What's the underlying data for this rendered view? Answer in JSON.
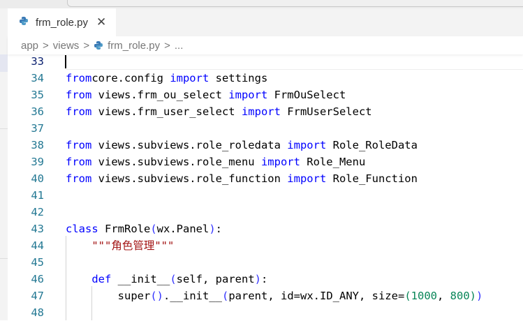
{
  "tab": {
    "filename": "frm_role.py",
    "icon": "python-icon",
    "close_icon": "close-icon"
  },
  "breadcrumb": {
    "items": [
      "app",
      "views",
      "frm_role.py",
      "..."
    ],
    "separator": ">"
  },
  "colors": {
    "keyword": "#0000ff",
    "string": "#a31515",
    "number": "#098658",
    "line_number": "#237893"
  },
  "editor": {
    "lines": [
      {
        "n": "33",
        "t": []
      },
      {
        "n": "34",
        "t": [
          [
            "kw",
            "from"
          ],
          [
            "",
            "core.config "
          ],
          [
            "kw",
            "import"
          ],
          [
            "",
            " settings"
          ]
        ]
      },
      {
        "n": "35",
        "t": [
          [
            "kw",
            "from"
          ],
          [
            "",
            " views.frm_ou_select "
          ],
          [
            "kw",
            "import"
          ],
          [
            "",
            " FrmOuSelect"
          ]
        ]
      },
      {
        "n": "36",
        "t": [
          [
            "kw",
            "from"
          ],
          [
            "",
            " views.frm_user_select "
          ],
          [
            "kw",
            "import"
          ],
          [
            "",
            " FrmUserSelect"
          ]
        ]
      },
      {
        "n": "37",
        "t": []
      },
      {
        "n": "38",
        "t": [
          [
            "kw",
            "from"
          ],
          [
            "",
            " views.subviews.role_roledata "
          ],
          [
            "kw",
            "import"
          ],
          [
            "",
            " Role_RoleData"
          ]
        ]
      },
      {
        "n": "39",
        "t": [
          [
            "kw",
            "from"
          ],
          [
            "",
            " views.subviews.role_menu "
          ],
          [
            "kw",
            "import"
          ],
          [
            "",
            " Role_Menu"
          ]
        ]
      },
      {
        "n": "40",
        "t": [
          [
            "kw",
            "from"
          ],
          [
            "",
            " views.subviews.role_function "
          ],
          [
            "kw",
            "import"
          ],
          [
            "",
            " Role_Function"
          ]
        ]
      },
      {
        "n": "41",
        "t": []
      },
      {
        "n": "42",
        "t": []
      },
      {
        "n": "43",
        "t": [
          [
            "kw",
            "class"
          ],
          [
            "",
            " FrmRole"
          ],
          [
            "br",
            "("
          ],
          [
            "",
            "wx.Panel"
          ],
          [
            "br",
            ")"
          ],
          [
            "",
            ":"
          ]
        ]
      },
      {
        "n": "44",
        "t": [
          [
            "",
            "    "
          ],
          [
            "str",
            "\"\"\"角色管理\"\"\""
          ]
        ]
      },
      {
        "n": "45",
        "t": []
      },
      {
        "n": "46",
        "t": [
          [
            "",
            "    "
          ],
          [
            "kw",
            "def"
          ],
          [
            "",
            " __init__"
          ],
          [
            "br",
            "("
          ],
          [
            "",
            "self, parent"
          ],
          [
            "br",
            ")"
          ],
          [
            "",
            ":"
          ]
        ]
      },
      {
        "n": "47",
        "t": [
          [
            "",
            "        super"
          ],
          [
            "br",
            "()"
          ],
          [
            "",
            ".__init__"
          ],
          [
            "br",
            "("
          ],
          [
            "",
            "parent, id=wx.ID_ANY, size="
          ],
          [
            "numl",
            "("
          ],
          [
            "numl",
            "1000"
          ],
          [
            "",
            ", "
          ],
          [
            "numl",
            "800"
          ],
          [
            "numl",
            ")"
          ],
          [
            "br",
            ")"
          ]
        ]
      },
      {
        "n": "48",
        "t": []
      }
    ]
  }
}
